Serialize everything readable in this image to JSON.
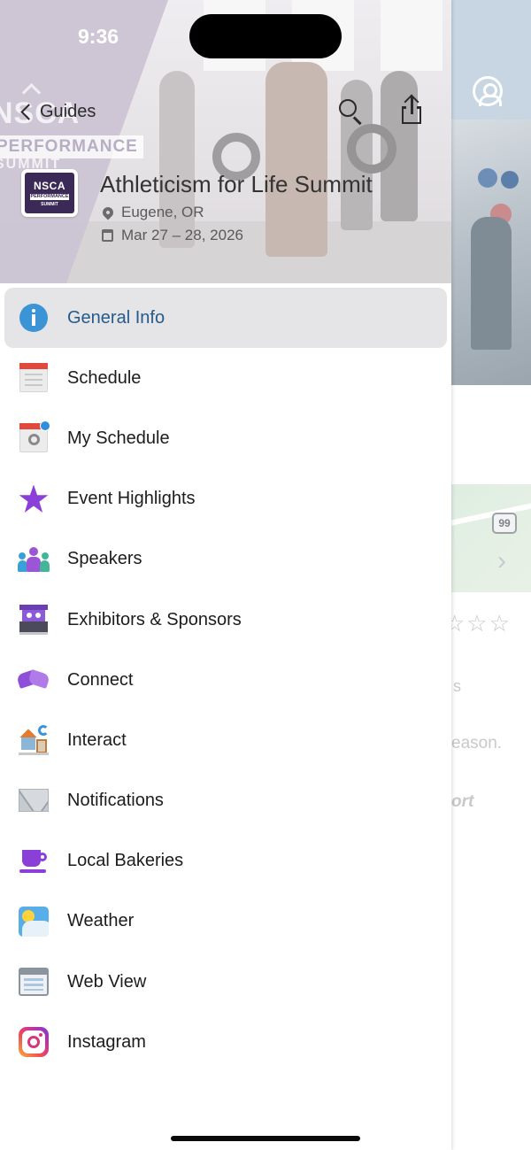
{
  "status_bar": {
    "time": "9:36"
  },
  "header": {
    "back_label": "Guides",
    "event_title": "Athleticism for Life Summit",
    "location": "Eugene, OR",
    "dates": "Mar 27 – 28, 2026",
    "logo_text": {
      "line1": "NSCA",
      "line2": "PERFORMANCE",
      "line3": "SUMMIT"
    },
    "background_logo_text": {
      "big": "NSCA",
      "perf": "PERFORMANCE",
      "summit": "SUMMIT"
    }
  },
  "menu": {
    "items": [
      {
        "label": "General Info",
        "icon": "info-icon",
        "active": true
      },
      {
        "label": "Schedule",
        "icon": "calendar-icon"
      },
      {
        "label": "My Schedule",
        "icon": "my-schedule-icon"
      },
      {
        "label": "Event Highlights",
        "icon": "star-icon"
      },
      {
        "label": "Speakers",
        "icon": "people-icon"
      },
      {
        "label": "Exhibitors & Sponsors",
        "icon": "booth-icon"
      },
      {
        "label": "Connect",
        "icon": "handshake-icon"
      },
      {
        "label": "Interact",
        "icon": "interact-icon"
      },
      {
        "label": "Notifications",
        "icon": "envelope-icon"
      },
      {
        "label": "Local Bakeries",
        "icon": "cup-icon"
      },
      {
        "label": "Weather",
        "icon": "weather-icon"
      },
      {
        "label": "Web View",
        "icon": "web-view-icon"
      },
      {
        "label": "Instagram",
        "icon": "instagram-icon"
      }
    ]
  },
  "background_page": {
    "route_shield": "99",
    "text_fragment_1": "s",
    "text_fragment_2": "eason.",
    "text_fragment_3": "ort"
  },
  "colors": {
    "active_item_bg": "#e5e5e7",
    "active_item_text": "#245b8c",
    "accent_purple": "#8b3fd9",
    "info_blue": "#3a94d6"
  }
}
